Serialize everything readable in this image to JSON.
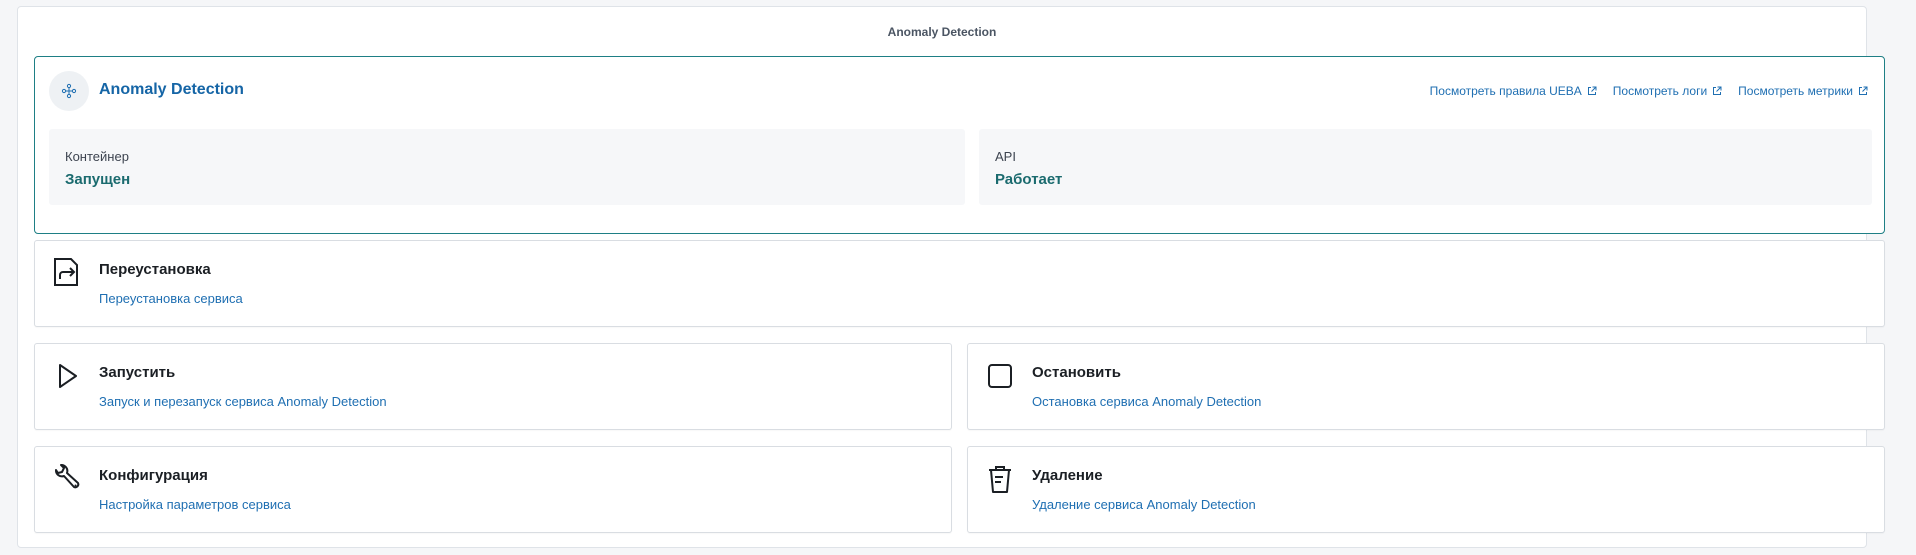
{
  "page": {
    "title": "Anomaly Detection"
  },
  "status_panel": {
    "icon": "network-nodes-icon",
    "title": "Anomaly Detection",
    "links": [
      {
        "label": "Посмотреть правила UEBA",
        "icon": "external-link-icon"
      },
      {
        "label": "Посмотреть логи",
        "icon": "external-link-icon"
      },
      {
        "label": "Посмотреть метрики",
        "icon": "external-link-icon"
      }
    ],
    "container": {
      "label": "Контейнер",
      "value": "Запущен"
    },
    "api": {
      "label": "API",
      "value": "Работает"
    }
  },
  "actions": {
    "reinstall": {
      "title": "Переустановка",
      "description": "Переустановка сервиса",
      "icon": "reinstall-icon"
    },
    "start": {
      "title": "Запустить",
      "description": "Запуск и перезапуск сервиса Anomaly Detection",
      "icon": "play-icon"
    },
    "stop": {
      "title": "Остановить",
      "description": "Остановка сервиса Anomaly Detection",
      "icon": "stop-icon"
    },
    "config": {
      "title": "Конфигурация",
      "description": "Настройка параметров сервиса",
      "icon": "wrench-icon"
    },
    "delete": {
      "title": "Удаление",
      "description": "Удаление сервиса Anomaly Detection",
      "icon": "trash-icon"
    }
  },
  "colors": {
    "accent": "#1e7f85",
    "link": "#1f6fb2",
    "status_ok": "#1b6b6f"
  }
}
